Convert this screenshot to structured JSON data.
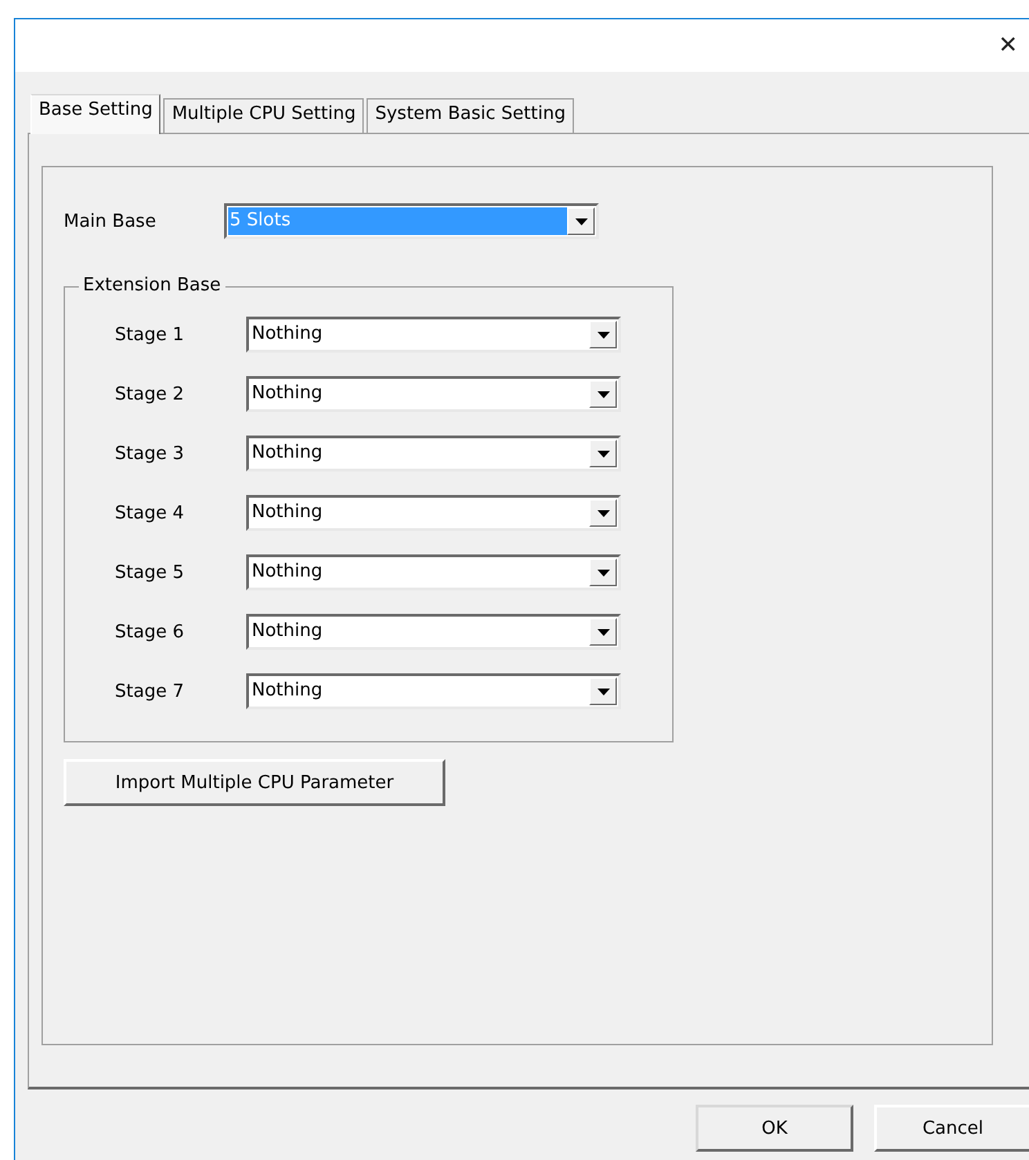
{
  "window": {
    "close": "✕"
  },
  "tabs": [
    {
      "label": "Base Setting",
      "selected": true
    },
    {
      "label": "Multiple CPU Setting",
      "selected": false
    },
    {
      "label": "System Basic Setting",
      "selected": false
    }
  ],
  "main_base": {
    "label": "Main Base",
    "value": "5 Slots",
    "focused": true
  },
  "extension_base": {
    "title": "Extension Base",
    "stages": [
      {
        "label": "Stage 1",
        "value": "Nothing"
      },
      {
        "label": "Stage 2",
        "value": "Nothing"
      },
      {
        "label": "Stage 3",
        "value": "Nothing"
      },
      {
        "label": "Stage 4",
        "value": "Nothing"
      },
      {
        "label": "Stage 5",
        "value": "Nothing"
      },
      {
        "label": "Stage 6",
        "value": "Nothing"
      },
      {
        "label": "Stage 7",
        "value": "Nothing"
      }
    ]
  },
  "import_button": "Import Multiple CPU Parameter",
  "buttons": [
    "OK",
    "Cancel"
  ]
}
